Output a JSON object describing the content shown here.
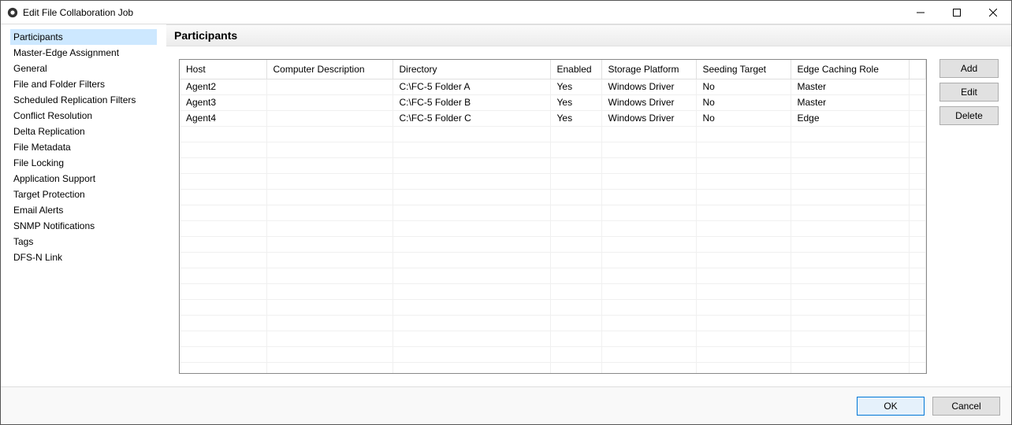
{
  "window": {
    "title": "Edit File Collaboration Job"
  },
  "sidebar": {
    "items": [
      {
        "label": "Participants"
      },
      {
        "label": "Master-Edge Assignment"
      },
      {
        "label": "General"
      },
      {
        "label": "File and Folder Filters"
      },
      {
        "label": "Scheduled Replication Filters"
      },
      {
        "label": "Conflict Resolution"
      },
      {
        "label": "Delta Replication"
      },
      {
        "label": "File Metadata"
      },
      {
        "label": "File Locking"
      },
      {
        "label": "Application Support"
      },
      {
        "label": "Target Protection"
      },
      {
        "label": "Email Alerts"
      },
      {
        "label": "SNMP Notifications"
      },
      {
        "label": "Tags"
      },
      {
        "label": "DFS-N Link"
      }
    ],
    "selected_index": 0
  },
  "main": {
    "heading": "Participants",
    "columns": {
      "host": "Host",
      "computer_description": "Computer Description",
      "directory": "Directory",
      "enabled": "Enabled",
      "storage_platform": "Storage Platform",
      "seeding_target": "Seeding Target",
      "edge_caching_role": "Edge Caching Role"
    },
    "rows": [
      {
        "host": "Agent2",
        "computer_description": "",
        "directory": "C:\\FC-5 Folder A",
        "enabled": "Yes",
        "storage_platform": "Windows Driver",
        "seeding_target": "No",
        "edge_caching_role": "Master"
      },
      {
        "host": "Agent3",
        "computer_description": "",
        "directory": "C:\\FC-5 Folder B",
        "enabled": "Yes",
        "storage_platform": "Windows Driver",
        "seeding_target": "No",
        "edge_caching_role": "Master"
      },
      {
        "host": "Agent4",
        "computer_description": "",
        "directory": "C:\\FC-5 Folder C",
        "enabled": "Yes",
        "storage_platform": "Windows Driver",
        "seeding_target": "No",
        "edge_caching_role": "Edge"
      }
    ],
    "buttons": {
      "add": "Add",
      "edit": "Edit",
      "delete": "Delete"
    }
  },
  "footer": {
    "ok": "OK",
    "cancel": "Cancel"
  }
}
